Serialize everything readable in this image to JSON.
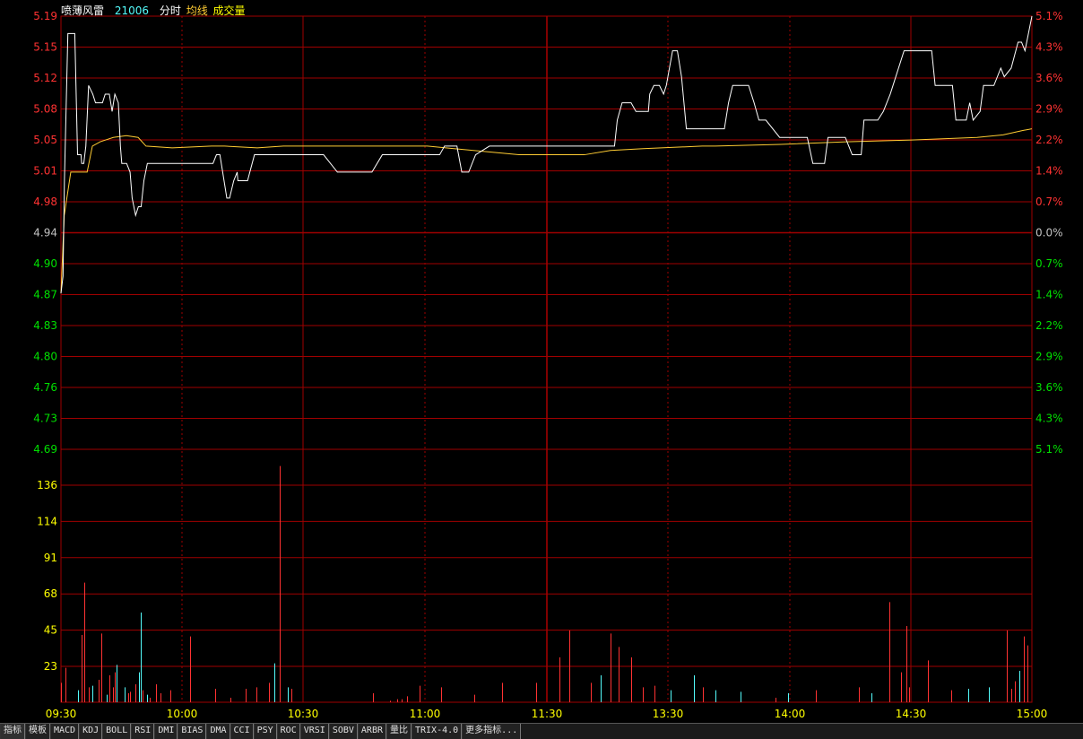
{
  "header": {
    "stock_name": "喷薄风雷",
    "stock_code": "21006",
    "mode": "分时",
    "avg_label": "均线",
    "vol_label": "成交量"
  },
  "colors": {
    "price_line": "#ffffff",
    "avg_line": "#ffcc33",
    "grid": "#a00000",
    "up": "#ff3232",
    "down": "#54fcfc",
    "label_up": "#ff3232",
    "label_down": "#00e000",
    "label_neutral": "#c0c0c0",
    "vol_label": "#ffff00"
  },
  "chart_data": {
    "type": "line",
    "prev_close": 4.94,
    "price_axis": {
      "left_labels": [
        "5.19",
        "5.15",
        "5.12",
        "5.08",
        "5.05",
        "5.01",
        "4.98",
        "4.94",
        "4.90",
        "4.87",
        "4.83",
        "4.80",
        "4.76",
        "4.73",
        "4.69"
      ],
      "right_labels": [
        "5.1%",
        "4.3%",
        "3.6%",
        "2.9%",
        "2.2%",
        "1.4%",
        "0.7%",
        "0.0%",
        "0.7%",
        "1.4%",
        "2.2%",
        "2.9%",
        "3.6%",
        "4.3%",
        "5.1%"
      ],
      "ylim": [
        4.69,
        5.19
      ]
    },
    "volume_axis": {
      "labels": [
        "136",
        "114",
        "91",
        "68",
        "45",
        "23"
      ],
      "ylim": [
        0,
        159
      ]
    },
    "x_labels": [
      "09:30",
      "10:00",
      "10:30",
      "11:00",
      "11:30",
      "13:30",
      "14:00",
      "14:30",
      "15:00"
    ],
    "price_series": {
      "name": "分时",
      "points": [
        [
          0,
          4.87
        ],
        [
          3,
          4.89
        ],
        [
          5,
          5.0
        ],
        [
          10,
          5.17
        ],
        [
          12,
          5.17
        ],
        [
          20,
          5.17
        ],
        [
          24,
          5.03
        ],
        [
          29,
          5.03
        ],
        [
          30,
          5.02
        ],
        [
          33,
          5.02
        ],
        [
          36,
          5.04
        ],
        [
          40,
          5.11
        ],
        [
          46,
          5.1
        ],
        [
          50,
          5.09
        ],
        [
          60,
          5.09
        ],
        [
          64,
          5.1
        ],
        [
          70,
          5.1
        ],
        [
          74,
          5.08
        ],
        [
          78,
          5.1
        ],
        [
          83,
          5.09
        ],
        [
          86,
          5.04
        ],
        [
          88,
          5.02
        ],
        [
          92,
          5.02
        ],
        [
          95,
          5.02
        ],
        [
          100,
          5.01
        ],
        [
          103,
          4.98
        ],
        [
          108,
          4.96
        ],
        [
          112,
          4.97
        ],
        [
          116,
          4.97
        ],
        [
          120,
          5.0
        ],
        [
          125,
          5.02
        ],
        [
          130,
          5.02
        ],
        [
          140,
          5.02
        ],
        [
          170,
          5.02
        ],
        [
          200,
          5.02
        ],
        [
          213,
          5.02
        ],
        [
          220,
          5.02
        ],
        [
          225,
          5.03
        ],
        [
          230,
          5.03
        ],
        [
          240,
          4.98
        ],
        [
          244,
          4.98
        ],
        [
          250,
          5.0
        ],
        [
          255,
          5.01
        ],
        [
          256,
          5.0
        ],
        [
          270,
          5.0
        ],
        [
          280,
          5.03
        ],
        [
          300,
          5.03
        ],
        [
          330,
          5.03
        ],
        [
          380,
          5.03
        ],
        [
          400,
          5.01
        ],
        [
          450,
          5.01
        ],
        [
          465,
          5.03
        ],
        [
          470,
          5.03
        ],
        [
          500,
          5.03
        ],
        [
          548,
          5.03
        ],
        [
          555,
          5.04
        ],
        [
          560,
          5.04
        ],
        [
          573,
          5.04
        ],
        [
          580,
          5.01
        ],
        [
          586,
          5.01
        ],
        [
          590,
          5.01
        ],
        [
          595,
          5.02
        ],
        [
          600,
          5.03
        ],
        [
          620,
          5.04
        ],
        [
          660,
          5.04
        ],
        [
          700,
          5.04
        ],
        [
          730,
          5.04
        ],
        [
          760,
          5.04
        ],
        [
          801,
          5.04
        ],
        [
          805,
          5.07
        ],
        [
          812,
          5.09
        ],
        [
          825,
          5.09
        ],
        [
          832,
          5.08
        ],
        [
          845,
          5.08
        ],
        [
          850,
          5.08
        ],
        [
          852,
          5.1
        ],
        [
          858,
          5.11
        ],
        [
          866,
          5.11
        ],
        [
          872,
          5.1
        ],
        [
          876,
          5.11
        ],
        [
          885,
          5.15
        ],
        [
          892,
          5.15
        ],
        [
          898,
          5.12
        ],
        [
          905,
          5.06
        ],
        [
          915,
          5.06
        ],
        [
          945,
          5.06
        ],
        [
          960,
          5.06
        ],
        [
          966,
          5.09
        ],
        [
          972,
          5.11
        ],
        [
          995,
          5.11
        ],
        [
          1003,
          5.09
        ],
        [
          1010,
          5.07
        ],
        [
          1020,
          5.07
        ],
        [
          1040,
          5.05
        ],
        [
          1060,
          5.05
        ],
        [
          1080,
          5.05
        ],
        [
          1088,
          5.02
        ],
        [
          1100,
          5.02
        ],
        [
          1105,
          5.02
        ],
        [
          1110,
          5.05
        ],
        [
          1135,
          5.05
        ],
        [
          1145,
          5.03
        ],
        [
          1150,
          5.03
        ],
        [
          1158,
          5.03
        ],
        [
          1162,
          5.07
        ],
        [
          1182,
          5.07
        ],
        [
          1190,
          5.08
        ],
        [
          1200,
          5.1
        ],
        [
          1220,
          5.15
        ],
        [
          1260,
          5.15
        ],
        [
          1265,
          5.11
        ],
        [
          1290,
          5.11
        ],
        [
          1295,
          5.07
        ],
        [
          1310,
          5.07
        ],
        [
          1315,
          5.09
        ],
        [
          1320,
          5.07
        ],
        [
          1330,
          5.08
        ],
        [
          1335,
          5.11
        ],
        [
          1350,
          5.11
        ],
        [
          1360,
          5.13
        ],
        [
          1365,
          5.12
        ],
        [
          1375,
          5.13
        ],
        [
          1385,
          5.16
        ],
        [
          1390,
          5.16
        ],
        [
          1395,
          5.15
        ],
        [
          1405,
          5.19
        ]
      ]
    },
    "avg_series": {
      "name": "均线",
      "points": [
        [
          0,
          4.87
        ],
        [
          5,
          4.96
        ],
        [
          15,
          5.01
        ],
        [
          40,
          5.01
        ],
        [
          48,
          5.04
        ],
        [
          60,
          5.045
        ],
        [
          80,
          5.05
        ],
        [
          100,
          5.052
        ],
        [
          118,
          5.05
        ],
        [
          130,
          5.04
        ],
        [
          170,
          5.038
        ],
        [
          200,
          5.039
        ],
        [
          230,
          5.04
        ],
        [
          250,
          5.04
        ],
        [
          300,
          5.038
        ],
        [
          340,
          5.04
        ],
        [
          400,
          5.04
        ],
        [
          500,
          5.04
        ],
        [
          560,
          5.04
        ],
        [
          700,
          5.03
        ],
        [
          800,
          5.03
        ],
        [
          840,
          5.035
        ],
        [
          890,
          5.037
        ],
        [
          980,
          5.04
        ],
        [
          1000,
          5.04
        ],
        [
          1100,
          5.042
        ],
        [
          1200,
          5.045
        ],
        [
          1300,
          5.047
        ],
        [
          1400,
          5.05
        ],
        [
          1440,
          5.053
        ],
        [
          1470,
          5.058
        ],
        [
          1484,
          5.06
        ]
      ]
    },
    "volumes": [
      [
        0,
        13,
        "up"
      ],
      [
        10,
        23,
        "up"
      ],
      [
        40,
        8,
        "down"
      ],
      [
        48,
        45,
        "up"
      ],
      [
        56,
        80,
        "up"
      ],
      [
        65,
        10,
        "up"
      ],
      [
        74,
        11,
        "down"
      ],
      [
        89,
        15,
        "up"
      ],
      [
        95,
        46,
        "up"
      ],
      [
        108,
        5,
        "down"
      ],
      [
        115,
        18,
        "up"
      ],
      [
        123,
        10,
        "up"
      ],
      [
        128,
        20,
        "up"
      ],
      [
        131,
        25,
        "down"
      ],
      [
        150,
        10,
        "down"
      ],
      [
        159,
        6,
        "up"
      ],
      [
        164,
        7,
        "up"
      ],
      [
        176,
        12,
        "up"
      ],
      [
        184,
        20,
        "down"
      ],
      [
        188,
        60,
        "down"
      ],
      [
        194,
        8,
        "up"
      ],
      [
        204,
        5,
        "down"
      ],
      [
        211,
        3,
        "up"
      ],
      [
        225,
        12,
        "up"
      ],
      [
        235,
        6,
        "up"
      ],
      [
        260,
        8,
        "up"
      ],
      [
        305,
        44,
        "up"
      ],
      [
        366,
        9,
        "up"
      ],
      [
        401,
        3,
        "up"
      ],
      [
        438,
        9,
        "up"
      ],
      [
        464,
        10,
        "up"
      ],
      [
        493,
        13,
        "up"
      ],
      [
        505,
        26,
        "down"
      ],
      [
        519,
        158,
        "up"
      ],
      [
        537,
        10,
        "down"
      ],
      [
        545,
        9,
        "up"
      ],
      [
        740,
        6,
        "up"
      ],
      [
        780,
        1,
        "up"
      ],
      [
        797,
        2,
        "up"
      ],
      [
        806,
        2,
        "up"
      ],
      [
        820,
        4,
        "up"
      ],
      [
        850,
        11,
        "up"
      ],
      [
        900,
        10,
        "up"
      ],
      [
        980,
        5,
        "up"
      ],
      [
        1045,
        13,
        "up"
      ],
      [
        1125,
        13,
        "up"
      ],
      [
        1180,
        30,
        "up"
      ],
      [
        1205,
        48,
        "up"
      ],
      [
        1255,
        13,
        "up"
      ],
      [
        1278,
        18,
        "down"
      ],
      [
        1301,
        46,
        "up"
      ],
      [
        1322,
        37,
        "up"
      ],
      [
        1351,
        30,
        "up"
      ],
      [
        1378,
        10,
        "up"
      ],
      [
        1405,
        11,
        "up"
      ],
      [
        1445,
        8,
        "down"
      ],
      [
        1500,
        18,
        "down"
      ],
      [
        1520,
        10,
        "up"
      ],
      [
        1550,
        8,
        "down"
      ],
      [
        1610,
        7,
        "down"
      ],
      [
        1693,
        3,
        "up"
      ],
      [
        1722,
        6,
        "down"
      ],
      [
        1788,
        8,
        "up"
      ],
      [
        1890,
        10,
        "up"
      ],
      [
        1920,
        6,
        "down"
      ],
      [
        1963,
        67,
        "up"
      ],
      [
        1990,
        20,
        "up"
      ],
      [
        2002,
        51,
        "up"
      ],
      [
        2010,
        10,
        "up"
      ],
      [
        2053,
        28,
        "up"
      ],
      [
        2108,
        8,
        "up"
      ],
      [
        2150,
        9,
        "down"
      ],
      [
        2197,
        10,
        "down"
      ],
      [
        2240,
        48,
        "up"
      ],
      [
        2252,
        9,
        "up"
      ],
      [
        2260,
        14,
        "up"
      ],
      [
        2270,
        21,
        "down"
      ],
      [
        2280,
        44,
        "up"
      ],
      [
        2290,
        38,
        "up"
      ]
    ]
  },
  "toolbar": {
    "tabs": [
      "指标",
      "模板",
      "MACD",
      "KDJ",
      "BOLL",
      "RSI",
      "DMI",
      "BIAS",
      "DMA",
      "CCI",
      "PSY",
      "ROC",
      "VRSI",
      "SOBV",
      "ARBR",
      "量比",
      "TRIX-4.0",
      "更多指标..."
    ]
  }
}
